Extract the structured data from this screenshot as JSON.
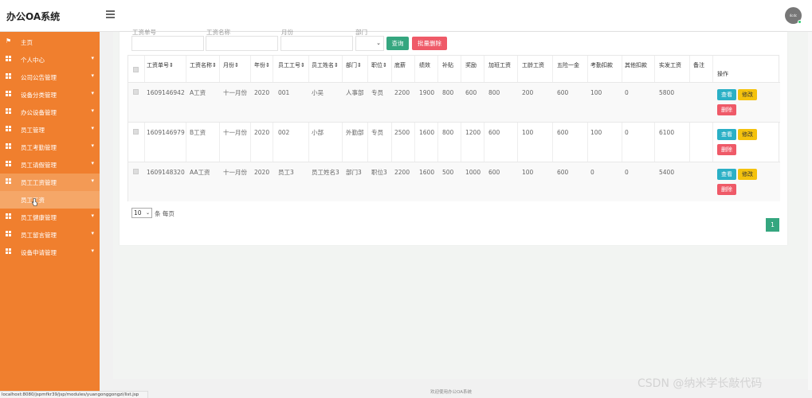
{
  "app": {
    "title": "办公OA系统",
    "avatar_text": "4cdc"
  },
  "sidebar": {
    "items": [
      {
        "label": "主页",
        "icon": "flag-icon"
      },
      {
        "label": "个人中心",
        "icon": "grid-icon"
      },
      {
        "label": "公司公告管理",
        "icon": "grid-icon"
      },
      {
        "label": "设备分类管理",
        "icon": "grid-icon"
      },
      {
        "label": "办公设备管理",
        "icon": "grid-icon"
      },
      {
        "label": "员工管理",
        "icon": "grid-icon"
      },
      {
        "label": "员工考勤管理",
        "icon": "grid-icon"
      },
      {
        "label": "员工请假管理",
        "icon": "grid-icon"
      },
      {
        "label": "员工工资管理",
        "icon": "grid-icon"
      },
      {
        "label": "员工健康管理",
        "icon": "grid-icon"
      },
      {
        "label": "员工留言管理",
        "icon": "grid-icon"
      },
      {
        "label": "设备申请管理",
        "icon": "grid-icon"
      }
    ],
    "submenu_label": "员工工资"
  },
  "search": {
    "labels": [
      "工资单号",
      "工资名称",
      "月份",
      "部门"
    ],
    "select_caret": "⌄",
    "search_button": "查询",
    "batch_delete_button": "批量删除"
  },
  "table": {
    "headers": [
      "工资单号",
      "工资名称",
      "月份",
      "年份",
      "员工工号",
      "员工姓名",
      "部门",
      "职位",
      "底薪",
      "绩效",
      "补贴",
      "奖励",
      "加班工资",
      "工龄工资",
      "五险一金",
      "考勤扣款",
      "其他扣款",
      "实发工资",
      "备注",
      "操作"
    ],
    "sort_marker": "⇕",
    "rows": [
      {
        "no": "1609146942",
        "name": "A工资",
        "month": "十一月份",
        "year": "2020",
        "emp_no": "001",
        "emp_name": "小吴",
        "dept": "人事部",
        "position": "专员",
        "base": "2200",
        "perf": "1900",
        "allowance": "800",
        "bonus": "600",
        "overtime": "800",
        "seniority": "200",
        "insurance": "600",
        "attendance_deduct": "100",
        "other_deduct": "0",
        "net": "5800",
        "note": ""
      },
      {
        "no": "1609146979",
        "name": "B工资",
        "month": "十一月份",
        "year": "2020",
        "emp_no": "002",
        "emp_name": "小部",
        "dept": "外勤部",
        "position": "专员",
        "base": "2500",
        "perf": "1600",
        "allowance": "800",
        "bonus": "1200",
        "overtime": "600",
        "seniority": "100",
        "insurance": "600",
        "attendance_deduct": "100",
        "other_deduct": "0",
        "net": "6100",
        "note": ""
      },
      {
        "no": "1609148320",
        "name": "AA工资",
        "month": "十一月份",
        "year": "2020",
        "emp_no": "员工3",
        "emp_name": "员工姓名3",
        "dept": "部门3",
        "position": "职位3",
        "base": "2200",
        "perf": "1600",
        "allowance": "500",
        "bonus": "1000",
        "overtime": "600",
        "seniority": "100",
        "insurance": "600",
        "attendance_deduct": "0",
        "other_deduct": "0",
        "net": "5400",
        "note": ""
      }
    ],
    "actions": {
      "view": "查看",
      "edit": "修改",
      "delete": "删除"
    }
  },
  "pager": {
    "page_size": "10",
    "page_size_label": "条 每页",
    "current_page": "1"
  },
  "footer": {
    "text": "欢迎使用办公OA系统"
  },
  "status_url": "localhost:8080/jspmfkr39/jsp/modules/yuangonggongzi/list.jsp",
  "watermark": "CSDN @纳米学长敲代码",
  "colors": {
    "sidebar": "#f07f2e",
    "primary": "#35a67f",
    "danger": "#ef5a68",
    "info": "#2bb0c6",
    "warning": "#f4c20d"
  }
}
